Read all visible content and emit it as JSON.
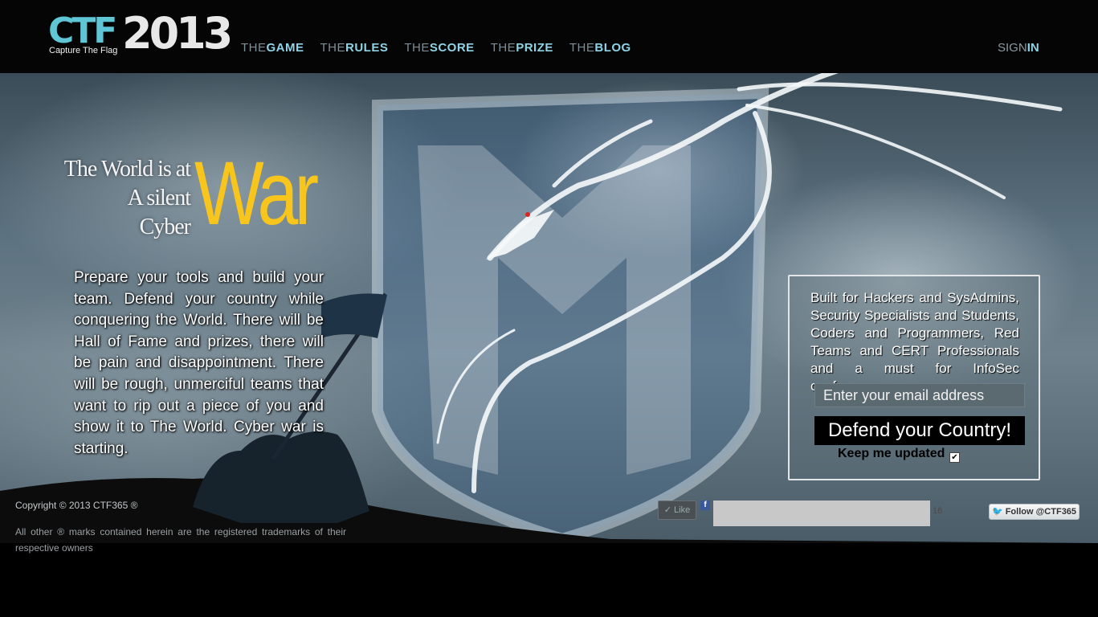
{
  "header": {
    "logo": {
      "ctf": "CTF",
      "year": "2013",
      "subtitle": "Capture The Flag"
    },
    "nav": [
      {
        "prefix": "THE",
        "label": "GAME"
      },
      {
        "prefix": "THE",
        "label": "RULES"
      },
      {
        "prefix": "THE",
        "label": "SCORE"
      },
      {
        "prefix": "THE",
        "label": "PRIZE"
      },
      {
        "prefix": "THE",
        "label": "BLOG"
      }
    ],
    "signin": {
      "prefix": "SIGN",
      "label": "IN"
    }
  },
  "hero": {
    "tagline": [
      "The World is at",
      "A silent",
      "Cyber"
    ],
    "war": "War",
    "intro": "Prepare your tools and build your team. Defend your country while conquering the World. There will be Hall of Fame and prizes, there will be pain and disappointment. There will be rough, unmerciful teams that want to rip out a piece of you and show it to The World. Cyber war is starting."
  },
  "signup": {
    "description": "Built for Hackers and SysAdmins, Security Specialists and Students, Coders and Programmers, Red Teams and CERT Professionals and a must for InfoSec conferences.",
    "email_placeholder": "Enter your email address",
    "submit_label": "Defend your Country!",
    "keep_updated_label": "Keep me updated",
    "keep_updated_checked": true
  },
  "footer": {
    "copyright": "Copyright © 2013 CTF365 ®",
    "trademark": "All other ® marks contained herein are the registered trademarks of their respective owners",
    "like_label": "Like",
    "like_count": "16",
    "follow_label": "Follow @CTF365"
  },
  "colors": {
    "accent_nav": "#8fd3e6",
    "logo_ctf": "#5fc6d6",
    "war": "#f7c51c"
  }
}
